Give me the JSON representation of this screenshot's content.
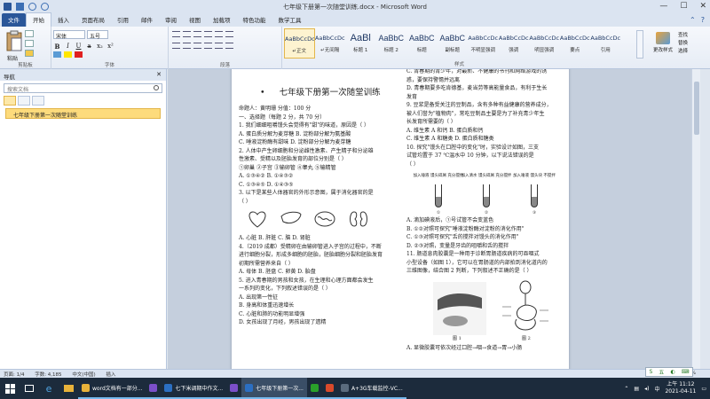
{
  "window": {
    "title": "七年级下册第一次随堂训练.docx - Microsoft Word"
  },
  "tabs": [
    "文件",
    "开始",
    "插入",
    "页面布局",
    "引用",
    "邮件",
    "审阅",
    "视图",
    "加载项",
    "特色功能",
    "数学工具"
  ],
  "ribbon": {
    "clipboard": {
      "paste": "粘贴",
      "label": "剪贴板"
    },
    "font": {
      "name": "宋体",
      "size": "五号",
      "label": "字体"
    },
    "paragraph": {
      "label": "段落"
    },
    "styles": {
      "label": "样式",
      "items": [
        {
          "sample": "AaBbCcDc",
          "name": "↵正文"
        },
        {
          "sample": "AaBbCcDc",
          "name": "↵无间隔"
        },
        {
          "sample": "AaBl",
          "name": "标题 1"
        },
        {
          "sample": "AaBbC",
          "name": "标题 2"
        },
        {
          "sample": "AaBbC",
          "name": "标题"
        },
        {
          "sample": "AaBbC",
          "name": "副标题"
        },
        {
          "sample": "AaBbCcDc",
          "name": "不明显强调"
        },
        {
          "sample": "AaBbCcDc",
          "name": "强调"
        },
        {
          "sample": "AaBbCcDc",
          "name": "明显强调"
        },
        {
          "sample": "AaBbCcDc",
          "name": "要点"
        },
        {
          "sample": "AaBbCcDc",
          "name": "引用"
        }
      ],
      "change": "更改样式"
    },
    "editing": {
      "find": "查找",
      "replace": "替换",
      "select": "选择",
      "label": "编辑"
    }
  },
  "nav": {
    "title": "导航",
    "search_placeholder": "搜索文档",
    "item": "七年级下册第一次随堂训练"
  },
  "doc": {
    "title": "七年级下册第一次随堂训练",
    "left_lines": [
      "命题人：黄明珊      分值：100 分",
      "一、选择题（每题 2 分，共 70 分）",
      "1. 我们细细咀嚼馒头会觉得有\"甜\"的味道，原因是（    ）",
      "A. 蛋白质分解为麦芽糖      B. 淀粉部分解为氨基酸",
      "C. 唾液淀粉酶有甜味        D. 淀粉部分分解为麦芽糖",
      "2. 人体中产生卵细胞和分泌雌性激素、产生精子和分泌雄",
      "性激素、受精以及胚胎发育的部位分别是（    ）",
      "①卵巢  ②子宫  ③输卵管  ④睾丸  ⑤输精管",
      "A. ①③④②      B. ①④③②",
      "C. ①③④⑤      D. ①④③⑤",
      "3. 以下是某些人体器官的外形示意图，属于消化器官的是",
      "（    ）"
    ],
    "left_lines2": [
      "A. 心脏        B. 肝脏        C. 脑        D. 肾脏",
      "4.（2019 成都）受精卵在由输卵管进入子宫的过程中，不断",
      "进行细胞分裂，形成多细胞的胚胎，胚胎细胞分裂和胚胎发育",
      "初期所需营养来自（    ）",
      "A. 母体  B. 胚盘  C. 卵黄  D. 胎盘",
      "5. 进入青春期的男孩和女孩，在生理和心理方面都会发生",
      "一系列的变化，下列叙述错误的是（    ）",
      "A. 出现第一性征",
      "B. 身高和体重迅速增长",
      "C. 心脏和肺的功能明显增强",
      "D. 女孩出现了月经，男孩出现了遗精"
    ],
    "right_lines": [
      "C. 青春期的青少年，对最新、不健康的书刊和网络游戏的诱",
      "惑，要保持警惕并远离",
      "D. 青春期要多吃肯德基，麦当劳等高能量食品，有利于生长",
      "发育",
      "9. 豆浆是备受关注的豆制品，含有多种有益健康的营养成分，",
      "被人们誉为\"植物肉\"，常吃豆制品主要是为了补充青少年生",
      "长发育所需要的（    ）",
      "A. 维生素 A 和钙        B. 蛋白质和钙",
      "C. 维生素 A 和糖类      D. 蛋白质和糖类",
      "10. 探究\"馒头在口腔中的变化\"时，实验设计如图，三支",
      "试管均置于 37 ℃温水中 10 分钟，以下说法错误的是",
      "（    ）"
    ],
    "tube_labels": [
      "加入唾液 馒头碎屑 充分搅拌",
      "加入清水 馒头碎屑 充分搅拌",
      "加入唾液 馒头块 不搅拌"
    ],
    "tube_numbers": [
      "①",
      "②",
      "③"
    ],
    "right_lines2": [
      "A. 滴加碘液后，①号试管不会变蓝色",
      "B. ①②对照可探究\"唾液淀粉酶对淀粉的消化作用\"",
      "C. ①③对照可探究\"舌的搅拌对馒头的消化作用\"",
      "D. ②③对照，变量是牙齿的咀嚼和舌的搅拌",
      "11. 肠道息肉胶囊是一种用于诊断胃肠道疾病的可吞咽式",
      "小型设备（如图 1），它可以在胃肠道的内部拍到消化道内的",
      "三维图像，结合图 2 判断，下列叙述不正确的是（    ）"
    ],
    "fig_labels": [
      "图 1",
      "图 2"
    ],
    "right_last": "A. 显微胶囊可依次经过口腔→咽→食道→胃→小肠"
  },
  "status": {
    "page": "页面: 1/4",
    "words": "字数: 4,185",
    "lang": "中文(中国)",
    "mode": "插入",
    "zoom": "100%"
  },
  "taskbar": {
    "apps": [
      {
        "label": "word文档有一部分...",
        "color": "#e8b23a"
      },
      {
        "label": "",
        "color": "#7b4fc9"
      },
      {
        "label": "七下米调期中作文...",
        "color": "#2b6fc2"
      },
      {
        "label": "",
        "color": "#7b4fc9"
      },
      {
        "label": "七年级下册第一次...",
        "color": "#2b6fc2"
      },
      {
        "label": "",
        "color": "#2aa12a"
      },
      {
        "label": "",
        "color": "#d94a2b"
      },
      {
        "label": "A+3G车载监控-VC...",
        "color": "#5a6b7d"
      }
    ],
    "time": "上午 11:12",
    "date": "2021-04-11",
    "ime": "五"
  }
}
